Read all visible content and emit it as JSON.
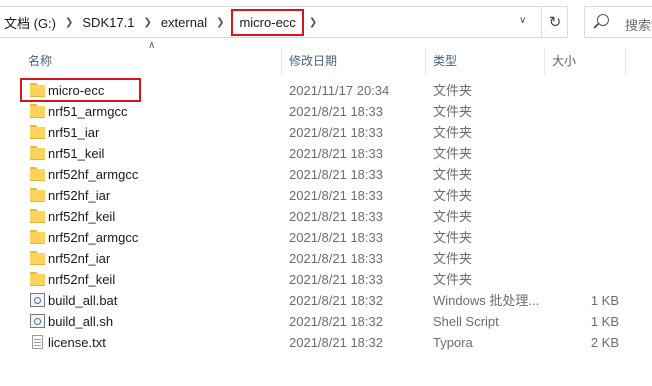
{
  "address_bar": {
    "crumbs": [
      "文档 (G:)",
      "SDK17.1",
      "external",
      "micro-ecc"
    ]
  },
  "search": {
    "placeholder": "搜索\""
  },
  "columns": {
    "name": "名称",
    "date": "修改日期",
    "type": "类型",
    "size": "大小"
  },
  "files": [
    {
      "name": "micro-ecc",
      "date": "2021/11/17 20:34",
      "type": "文件夹",
      "size": "",
      "icon": "folder-icon"
    },
    {
      "name": "nrf51_armgcc",
      "date": "2021/8/21 18:33",
      "type": "文件夹",
      "size": "",
      "icon": "folder-icon"
    },
    {
      "name": "nrf51_iar",
      "date": "2021/8/21 18:33",
      "type": "文件夹",
      "size": "",
      "icon": "folder-icon"
    },
    {
      "name": "nrf51_keil",
      "date": "2021/8/21 18:33",
      "type": "文件夹",
      "size": "",
      "icon": "folder-icon"
    },
    {
      "name": "nrf52hf_armgcc",
      "date": "2021/8/21 18:33",
      "type": "文件夹",
      "size": "",
      "icon": "folder-icon"
    },
    {
      "name": "nrf52hf_iar",
      "date": "2021/8/21 18:33",
      "type": "文件夹",
      "size": "",
      "icon": "folder-icon"
    },
    {
      "name": "nrf52hf_keil",
      "date": "2021/8/21 18:33",
      "type": "文件夹",
      "size": "",
      "icon": "folder-icon"
    },
    {
      "name": "nrf52nf_armgcc",
      "date": "2021/8/21 18:33",
      "type": "文件夹",
      "size": "",
      "icon": "folder-icon"
    },
    {
      "name": "nrf52nf_iar",
      "date": "2021/8/21 18:33",
      "type": "文件夹",
      "size": "",
      "icon": "folder-icon"
    },
    {
      "name": "nrf52nf_keil",
      "date": "2021/8/21 18:33",
      "type": "文件夹",
      "size": "",
      "icon": "folder-icon"
    },
    {
      "name": "build_all.bat",
      "date": "2021/8/21 18:32",
      "type": "Windows 批处理...",
      "size": "1 KB",
      "icon": "batch-file-icon"
    },
    {
      "name": "build_all.sh",
      "date": "2021/8/21 18:32",
      "type": "Shell Script",
      "size": "1 KB",
      "icon": "shell-script-icon"
    },
    {
      "name": "license.txt",
      "date": "2021/8/21 18:32",
      "type": "Typora",
      "size": "2 KB",
      "icon": "text-file-icon"
    }
  ],
  "colors": {
    "highlight": "#d9151b",
    "header_text": "#4c607a",
    "folder": "#fcd45c"
  }
}
